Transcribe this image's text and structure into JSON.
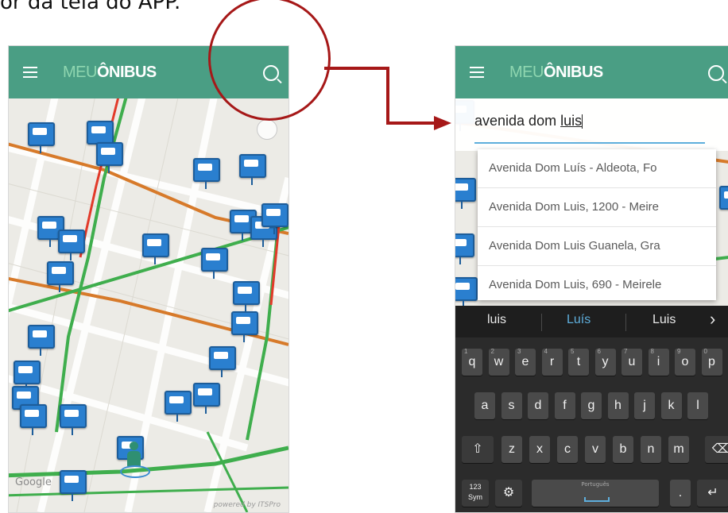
{
  "caption": "or da tela do APP.",
  "colors": {
    "appbar": "#4a9e84",
    "annotation": "#a61818",
    "bus_marker": "#2a7fcf",
    "keyboard_bg": "#2b2b2b"
  },
  "app": {
    "brand_part1": "MEU",
    "brand_part2": "ÔNIBUS"
  },
  "left_screen": {
    "icons": [
      "menu-icon",
      "search-icon",
      "my-location-icon",
      "bus-stop-icon",
      "person-icon"
    ],
    "map_labels": [
      "Google"
    ],
    "footer": "powered by ITSPro"
  },
  "right_screen": {
    "search_query_prefix": "avenida dom ",
    "search_query_underlined": "luis",
    "suggestions": [
      "Avenida Dom Luís - Aldeota, Fo",
      "Avenida Dom Luis, 1200 - Meire",
      "Avenida Dom Luis Guanela, Gra",
      "Avenida Dom Luis, 690 - Meirele"
    ],
    "keyboard": {
      "word_suggestions": [
        "luis",
        "Luís",
        "Luis",
        "›"
      ],
      "row1": [
        {
          "label": "q",
          "hint": "1"
        },
        {
          "label": "w",
          "hint": "2"
        },
        {
          "label": "e",
          "hint": "3"
        },
        {
          "label": "r",
          "hint": "4"
        },
        {
          "label": "t",
          "hint": "5"
        },
        {
          "label": "y",
          "hint": "6"
        },
        {
          "label": "u",
          "hint": "7"
        },
        {
          "label": "i",
          "hint": "8"
        },
        {
          "label": "o",
          "hint": "9"
        },
        {
          "label": "p",
          "hint": "0"
        }
      ],
      "row2": [
        "a",
        "s",
        "d",
        "f",
        "g",
        "h",
        "j",
        "k",
        "l"
      ],
      "row3": [
        "z",
        "x",
        "c",
        "v",
        "b",
        "n",
        "m"
      ],
      "shift_label": "⇧",
      "backspace_label": "⌫",
      "sym_label_1": "123",
      "sym_label_2": "Sym",
      "settings_label": "⚙",
      "space_language": "Português",
      "period_label": ".",
      "enter_label": "↵"
    }
  }
}
